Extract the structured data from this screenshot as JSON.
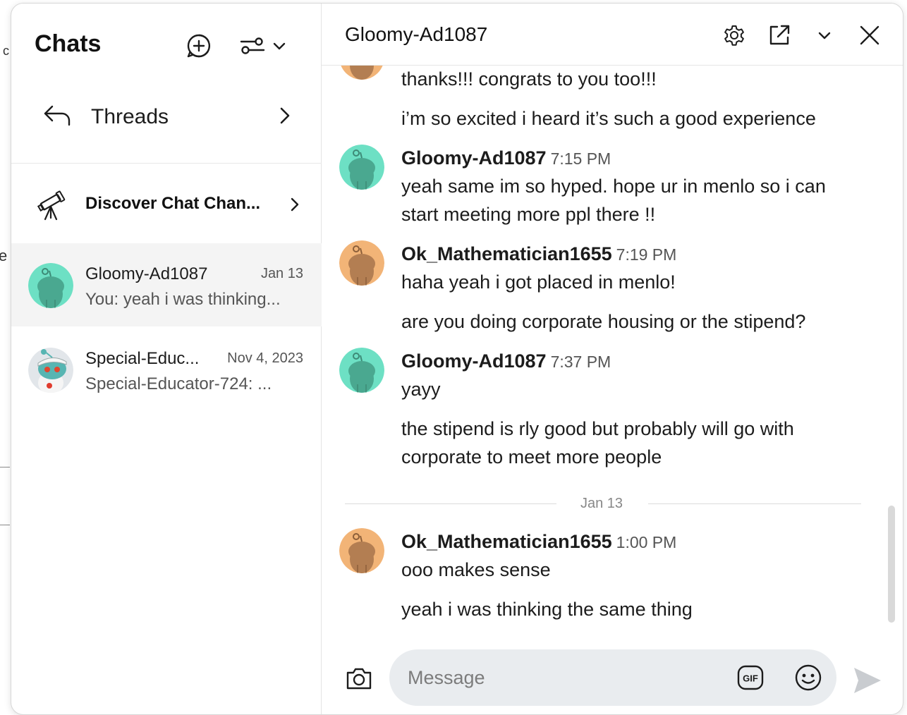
{
  "sidebar": {
    "title": "Chats",
    "threads_label": "Threads",
    "discover_label": "Discover Chat Chan...",
    "chats": [
      {
        "name": "Gloomy-Ad1087",
        "date": "Jan 13",
        "preview": "You: yeah i was thinking..."
      },
      {
        "name": "Special-Educ...",
        "date": "Nov 4, 2023",
        "preview": "Special-Educator-724: ..."
      }
    ]
  },
  "conversation": {
    "title": "Gloomy-Ad1087",
    "messages": {
      "m0_line1": "thanks!!! congrats to you too!!!",
      "m0_line2": "i’m so excited i heard it’s such a good experience",
      "m1_author": "Gloomy-Ad1087",
      "m1_time": "7:15 PM",
      "m1_line1": "yeah same im so hyped. hope ur in menlo so i can",
      "m1_line2": "start meeting more ppl there !!",
      "m2_author": "Ok_Mathematician1655",
      "m2_time": "7:19 PM",
      "m2_line1": "haha yeah i got placed in menlo!",
      "m2_line2": "are you doing corporate housing or the stipend?",
      "m3_author": "Gloomy-Ad1087",
      "m3_time": "7:37 PM",
      "m3_line1": "yayy",
      "m3_line2": "the stipend is rly good but probably will go with",
      "m3_line3": "corporate to meet more people",
      "date_separator": "Jan 13",
      "m4_author": "Ok_Mathematician1655",
      "m4_time": "1:00 PM",
      "m4_line1": "ooo makes sense",
      "m4_line2": "yeah i was thinking the same thing"
    },
    "composer": {
      "placeholder": "Message",
      "gif_label": "GIF"
    }
  },
  "icons": {
    "new_chat": "new-chat-icon",
    "filter": "filter-icon",
    "chevron_down": "chevron-down-icon",
    "back": "reply-arrow-icon",
    "chevron_right": "chevron-right-icon",
    "telescope": "telescope-icon",
    "settings": "gear-icon",
    "popout": "external-link-icon",
    "close": "close-icon",
    "camera": "camera-icon",
    "gif": "gif-icon",
    "emoji": "emoji-icon",
    "send": "send-icon"
  },
  "colors": {
    "avatar_teal": "#6de0c4",
    "avatar_teal_body": "#4aa890",
    "avatar_orange": "#f2b477",
    "avatar_orange_body": "#b37e52",
    "active_row": "#f4f4f4",
    "input_bg": "#e9ecef"
  }
}
